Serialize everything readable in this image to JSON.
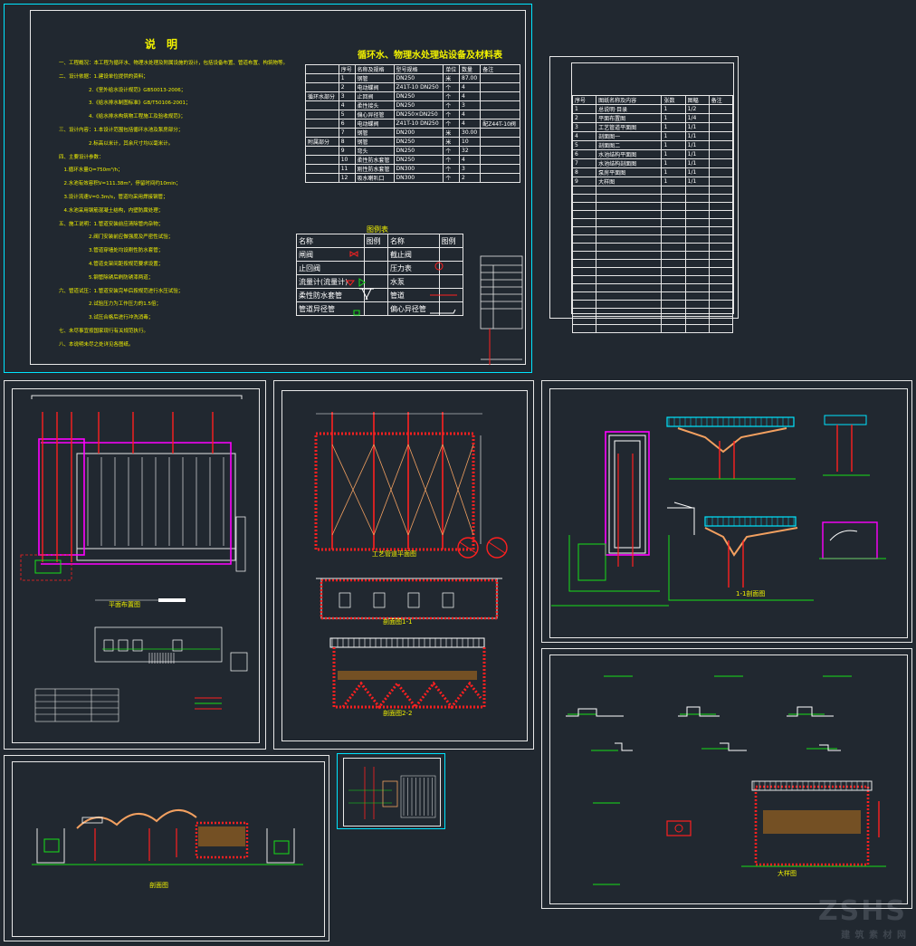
{
  "sheet1": {
    "notes_title": "说　明",
    "notes_lines": [
      "一、工程概况：本工程为循环水、物理水处理及附属设施的设计，包括设备布置、管道布置、构筑物等。",
      "二、设计依据：1.建设单位提供的资料；",
      "　　　　　　2.《室外给水设计规范》GB50013-2006；",
      "　　　　　　3.《给水排水制图标准》GB/T50106-2001；",
      "　　　　　　4.《给水排水构筑物工程施工及验收规范》；",
      "三、设计内容：1.本设计范围包括循环水池及泵房部分；",
      "　　　　　　2.标高以米计，其余尺寸均以毫米计。",
      "四、主要设计参数：",
      "　1.循环水量Q=750m³/h；",
      "　2.水池有效容积V=111.38m³，停留时间约10min；",
      "　3.设计流速V=0.3m/s，管道均采用焊接钢管；",
      "　4.水池采用钢筋混凝土结构，内壁防腐处理；",
      "五、施工说明：1.管道安装前应清除管内杂物；",
      "　　　　　　2.阀门安装前应做强度及严密性试验；",
      "　　　　　　3.管道穿墙处均设刚性防水套管；",
      "　　　　　　4.管道支架间距按规范要求设置；",
      "　　　　　　5.钢管除锈后刷防锈漆两道；",
      "六、管道试压：1.管道安装完毕后按规范进行水压试验；",
      "　　　　　　2.试验压力为工作压力的1.5倍；",
      "　　　　　　3.试压合格后进行冲洗消毒；",
      "七、未尽事宜按国家现行有关规范执行。",
      "八、本说明未尽之处详见各图纸。"
    ],
    "equip_title": "循环水、物理水处理站设备及材料表",
    "equip_headers": [
      "",
      "序号",
      "名称及规格",
      "型号规格",
      "单位",
      "数量",
      "备注"
    ],
    "equip_rows": [
      [
        "",
        "1",
        "钢管",
        "DN250",
        "米",
        "87.00",
        ""
      ],
      [
        "",
        "2",
        "电动蝶阀",
        "Z41T-10 DN250",
        "个",
        "4",
        ""
      ],
      [
        "",
        "3",
        "止回阀",
        "DN250",
        "个",
        "4",
        ""
      ],
      [
        "",
        "4",
        "柔性接头",
        "DN250",
        "个",
        "3",
        ""
      ],
      [
        "",
        "5",
        "偏心异径管",
        "DN250×DN250",
        "个",
        "4",
        ""
      ],
      [
        "",
        "6",
        "电动蝶阀",
        "Z41T-10 DN250",
        "个",
        "4",
        "配Z44T-10阀"
      ],
      [
        "",
        "7",
        "钢管",
        "DN200",
        "米",
        "30.00",
        ""
      ],
      [
        "",
        "8",
        "钢管",
        "DN250",
        "米",
        "10",
        ""
      ],
      [
        "",
        "9",
        "弯头",
        "DN250",
        "个",
        "32",
        ""
      ],
      [
        "",
        "10",
        "柔性防水套管",
        "DN250",
        "个",
        "4",
        ""
      ],
      [
        "",
        "11",
        "刚性防水套管",
        "DN300",
        "个",
        "3",
        ""
      ],
      [
        "",
        "12",
        "吸水喇叭口",
        "DN300",
        "个",
        "2",
        ""
      ]
    ],
    "equip_group_1": "循环水部分",
    "equip_group_2": "附属部分",
    "legend_title": "图例表",
    "legend_headers": [
      "名称",
      "图例",
      "名称",
      "图例"
    ],
    "legend_rows": [
      [
        "闸阀",
        "",
        "截止阀",
        ""
      ],
      [
        "止回阀",
        "",
        "压力表",
        ""
      ],
      [
        "流量计(流量计)",
        "",
        "水泵",
        ""
      ],
      [
        "柔性防水套管",
        "",
        "管道",
        ""
      ],
      [
        "管道异径管",
        "",
        "偏心异径管",
        ""
      ]
    ]
  },
  "sheet2": {
    "index_headers": [
      "序号",
      "图纸名称及内容",
      "张数",
      "图幅",
      "备注"
    ],
    "index_rows": [
      [
        "1",
        "总说明·目录",
        "1",
        "1/2",
        ""
      ],
      [
        "2",
        "平面布置图",
        "1",
        "1/4",
        ""
      ],
      [
        "3",
        "工艺管道平面图",
        "1",
        "1/1",
        ""
      ],
      [
        "4",
        "剖面图一",
        "1",
        "1/1",
        ""
      ],
      [
        "5",
        "剖面图二",
        "1",
        "1/1",
        ""
      ],
      [
        "6",
        "水池结构平面图",
        "1",
        "1/1",
        ""
      ],
      [
        "7",
        "水池结构剖面图",
        "1",
        "1/1",
        ""
      ],
      [
        "8",
        "泵房平面图",
        "1",
        "1/1",
        ""
      ],
      [
        "9",
        "大样图",
        "1",
        "1/1",
        ""
      ]
    ]
  },
  "drawings": {
    "d3_title": "平面布置图",
    "d4_title": "工艺管道平面图",
    "d4_sec1": "剖面图1-1",
    "d4_sec2": "剖面图2-2",
    "d5_title": "1-1剖面图",
    "d7_title": "剖面图",
    "d8_title": "大样图"
  },
  "watermark": {
    "brand": "ZSHS",
    "sub": "建 筑 素 材 网"
  },
  "colors": {
    "bg": "#212830",
    "frame": "#e8e8e8",
    "cyan": "#00e5ff",
    "red": "#ff2020",
    "green": "#18e018",
    "magenta": "#ff00ff",
    "yellow": "#f2f200"
  }
}
